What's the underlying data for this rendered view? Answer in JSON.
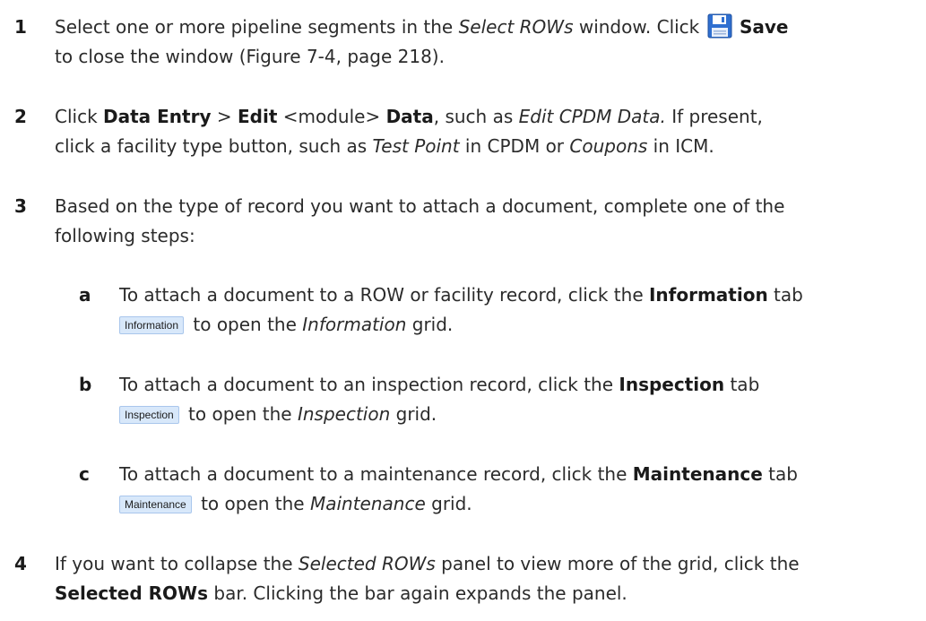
{
  "steps": [
    {
      "num": "1",
      "t1": "Select one or more pipeline segments in the ",
      "t2": "Select ROWs",
      "t3": " window. Click ",
      "save_icon": "save-icon",
      "t4": "Save",
      "t5": "to close the window (Figure 7-4, page 218)."
    },
    {
      "num": "2",
      "t1": "Click ",
      "t2": "Data Entry",
      "t3": " > ",
      "t4": "Edit",
      "t5": " <module> ",
      "t6": "Data",
      "t7": ", such as ",
      "t8": "Edit CPDM Data.",
      "t9": " If present,",
      "t10": "click a facility type button, such as ",
      "t11": "Test Point",
      "t12": " in CPDM or ",
      "t13": "Coupons",
      "t14": " in ICM."
    },
    {
      "num": "3",
      "t1": "Based on the type of record you want to attach a document, complete one of the",
      "t2": "following steps:"
    },
    {
      "num": "4",
      "t1": "If you want to collapse the ",
      "t2": "Selected ROWs",
      "t3": " panel to view more of the grid, click the",
      "t4": "Selected ROWs",
      "t5": " bar. Clicking the bar again expands the panel."
    }
  ],
  "substeps": [
    {
      "letter": "a",
      "t1": "To attach a document to a ROW or facility record, click the ",
      "t2": "Information",
      "t3": " tab",
      "chip": "Information",
      "t4": " to open the ",
      "t5": "Information",
      "t6": " grid."
    },
    {
      "letter": "b",
      "t1": "To attach a document to an inspection record, click the ",
      "t2": "Inspection",
      "t3": " tab",
      "chip": "Inspection",
      "t4": " to open the ",
      "t5": "Inspection",
      "t6": " grid."
    },
    {
      "letter": "c",
      "t1": "To attach a document to a maintenance record, click the ",
      "t2": "Maintenance",
      "t3": " tab",
      "chip": "Maintenance",
      "t4": " to open the ",
      "t5": "Maintenance",
      "t6": " grid."
    }
  ],
  "colors": {
    "text": "#2b2b2b",
    "tab_chip_bg": "#d8e8fa",
    "tab_chip_border": "#a9c6ec",
    "save_icon_blue": "#2f6fd0"
  }
}
